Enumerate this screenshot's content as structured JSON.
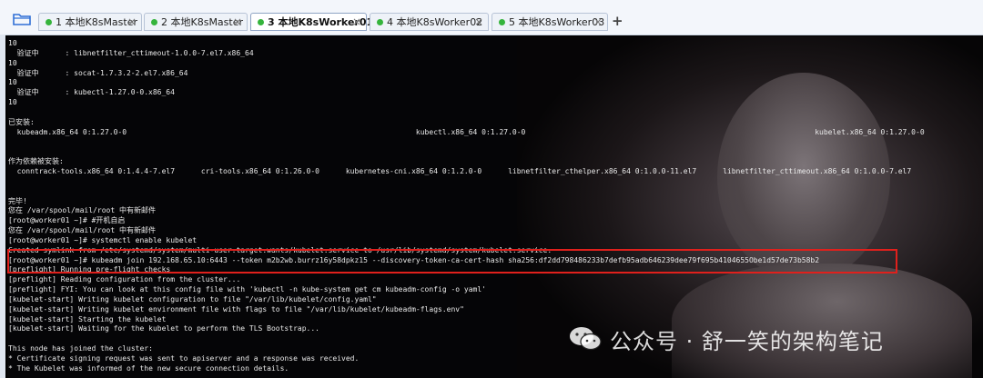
{
  "tabs": [
    {
      "label": "1 本地K8sMaster",
      "close": "×"
    },
    {
      "label": "2 本地K8sMaster",
      "close": "×"
    },
    {
      "label": "3 本地K8sWorker01",
      "close": "×"
    },
    {
      "label": "4 本地K8sWorker02",
      "close": "×"
    },
    {
      "label": "5 本地K8sWorker03",
      "close": "×"
    }
  ],
  "active_tab_index": 2,
  "new_tab_label": "+",
  "terminal_lines": [
    "10",
    "  验证中      : libnetfilter_cttimeout-1.0.0-7.el7.x86_64",
    "10",
    "  验证中      : socat-1.7.3.2-2.el7.x86_64",
    "10",
    "  验证中      : kubectl-1.27.0-0.x86_64",
    "10",
    "",
    "已安装:",
    "  kubeadm.x86_64 0:1.27.0-0                                                                  kubectl.x86_64 0:1.27.0-0                                                                  kubelet.x86_64 0:1.27.0-0",
    "",
    "",
    "作为依赖被安装:",
    "  conntrack-tools.x86_64 0:1.4.4-7.el7      cri-tools.x86_64 0:1.26.0-0      kubernetes-cni.x86_64 0:1.2.0-0      libnetfilter_cthelper.x86_64 0:1.0.0-11.el7      libnetfilter_cttimeout.x86_64 0:1.0.0-7.el7",
    "",
    "",
    "完毕!",
    "您在 /var/spool/mail/root 中有新邮件",
    "[root@worker01 ~]# #开机自启",
    "您在 /var/spool/mail/root 中有新邮件",
    "[root@worker01 ~]# systemctl enable kubelet",
    "Created symlink from /etc/systemd/system/multi-user.target.wants/kubelet.service to /usr/lib/systemd/system/kubelet.service.",
    "[root@worker01 ~]# kubeadm join 192.168.65.10:6443 --token m2b2wb.burrz16y58dpkz15 --discovery-token-ca-cert-hash sha256:df2dd798486233b7defb95adb646239dee79f695b4104655Obe1d57de73b58b2",
    "[preflight] Running pre-flight checks",
    "[preflight] Reading configuration from the cluster...",
    "[preflight] FYI: You can look at this config file with 'kubectl -n kube-system get cm kubeadm-config -o yaml'",
    "[kubelet-start] Writing kubelet configuration to file \"/var/lib/kubelet/config.yaml\"",
    "[kubelet-start] Writing kubelet environment file with flags to file \"/var/lib/kubelet/kubeadm-flags.env\"",
    "[kubelet-start] Starting the kubelet",
    "[kubelet-start] Waiting for the kubelet to perform the TLS Bootstrap...",
    "",
    "This node has joined the cluster:",
    "* Certificate signing request was sent to apiserver and a response was received.",
    "* The Kubelet was informed of the new secure connection details."
  ],
  "watermark": "公众号 · 舒一笑的架构笔记",
  "colors": {
    "tab_dot": "#35b43c",
    "highlight": "#e0201c",
    "terminal_text": "#e9e9e9"
  }
}
